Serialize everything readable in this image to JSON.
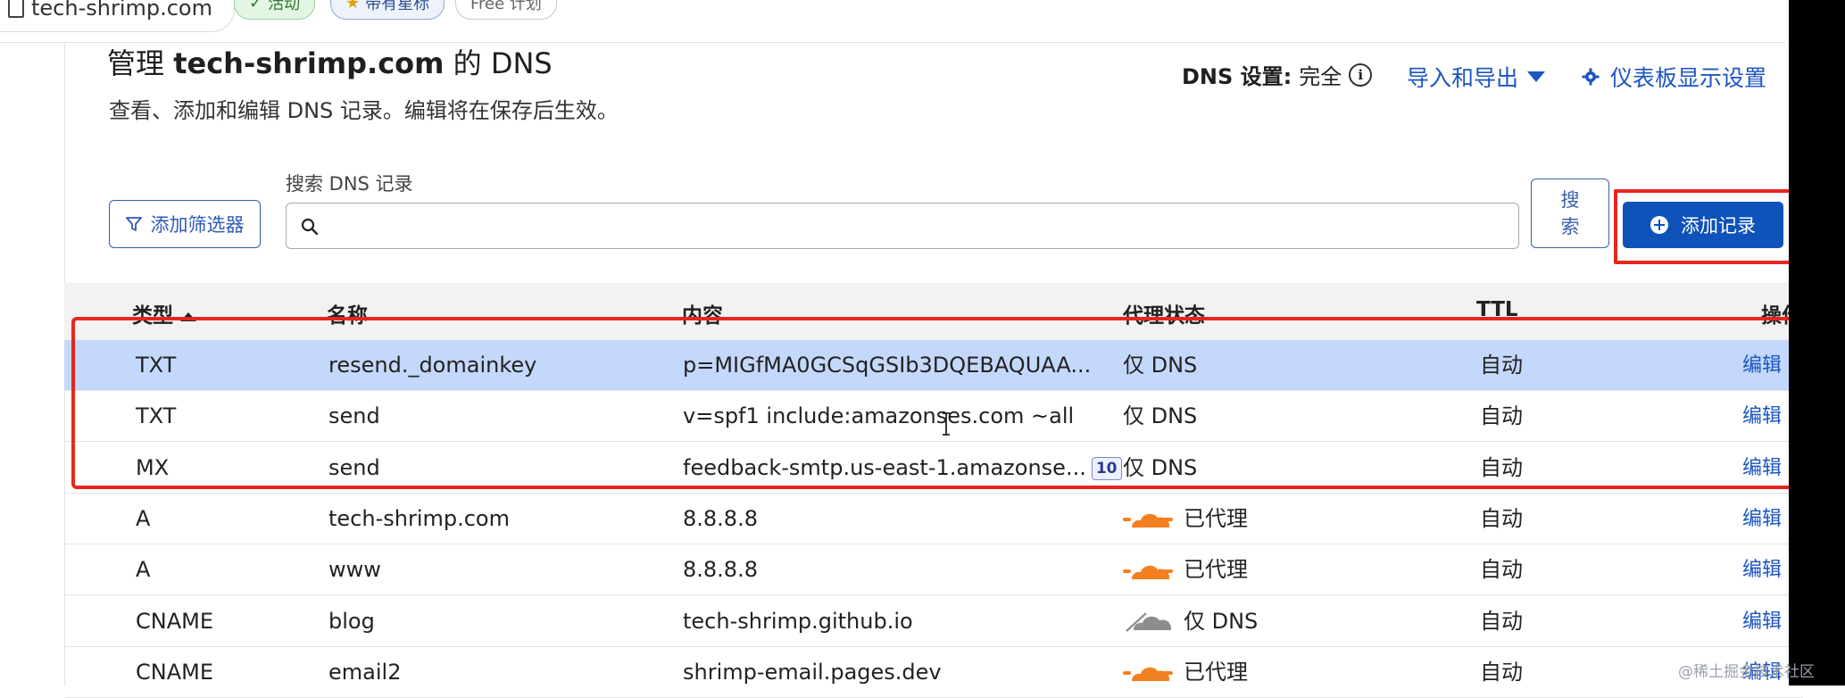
{
  "topbar": {
    "domain": "tech-shrimp.com",
    "status_badge": "活动",
    "star_badge": "带有星标",
    "plan_badge": "Free 计划"
  },
  "header": {
    "title_prefix": "管理",
    "title_domain": "tech-shrimp.com",
    "title_suffix": "的 DNS",
    "subtitle": "查看、添加和编辑 DNS 记录。编辑将在保存后生效。",
    "dns_setting_label": "DNS 设置:",
    "dns_setting_value": "完全",
    "import_export": "导入和导出",
    "dashboard_settings": "仪表板显示设置"
  },
  "toolbar": {
    "filter_button": "添加筛选器",
    "search_label": "搜索 DNS 记录",
    "search_placeholder": "",
    "search_button": "搜索",
    "add_record_button": "添加记录"
  },
  "table": {
    "columns": [
      "类型",
      "名称",
      "内容",
      "代理状态",
      "TTL",
      "操作"
    ],
    "rows": [
      {
        "type": "TXT",
        "name": "resend._domainkey",
        "content": "p=MIGfMA0GCSqGSIb3DQEBAQUAA...",
        "priority": "",
        "proxy": "仅 DNS",
        "proxy_kind": "none",
        "ttl": "自动",
        "action": "编辑"
      },
      {
        "type": "TXT",
        "name": "send",
        "content": "v=spf1 include:amazonses.com ~all",
        "priority": "",
        "proxy": "仅 DNS",
        "proxy_kind": "none",
        "ttl": "自动",
        "action": "编辑"
      },
      {
        "type": "MX",
        "name": "send",
        "content": "feedback-smtp.us-east-1.amazonse...",
        "priority": "10",
        "proxy": "仅 DNS",
        "proxy_kind": "none",
        "ttl": "自动",
        "action": "编辑"
      },
      {
        "type": "A",
        "name": "tech-shrimp.com",
        "content": "8.8.8.8",
        "priority": "",
        "proxy": "已代理",
        "proxy_kind": "proxied",
        "ttl": "自动",
        "action": "编辑"
      },
      {
        "type": "A",
        "name": "www",
        "content": "8.8.8.8",
        "priority": "",
        "proxy": "已代理",
        "proxy_kind": "proxied",
        "ttl": "自动",
        "action": "编辑"
      },
      {
        "type": "CNAME",
        "name": "blog",
        "content": "tech-shrimp.github.io",
        "priority": "",
        "proxy": "仅 DNS",
        "proxy_kind": "dns-cloud",
        "ttl": "自动",
        "action": "编辑"
      },
      {
        "type": "CNAME",
        "name": "email2",
        "content": "shrimp-email.pages.dev",
        "priority": "",
        "proxy": "已代理",
        "proxy_kind": "proxied",
        "ttl": "自动",
        "action": "编辑"
      }
    ]
  },
  "colors": {
    "accent": "#0f52b9",
    "link": "#1b55c0",
    "highlight_box": "#e8261f",
    "selected_row": "#c4d8fb",
    "proxied_cloud": "#f38020"
  },
  "watermark": "@稀土掘金技术社区"
}
